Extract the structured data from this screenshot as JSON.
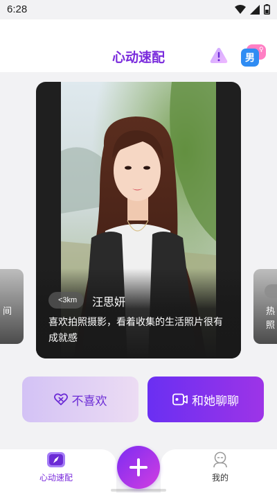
{
  "status_bar": {
    "time": "6:28"
  },
  "header": {
    "title": "心动速配",
    "gender_label": "男",
    "gender_badge": "♀"
  },
  "side_left": {
    "lines": [
      "间"
    ]
  },
  "side_right": {
    "lines": [
      "热",
      "照"
    ]
  },
  "card": {
    "distance": "<3km",
    "name": "汪思妍",
    "bio": "喜欢拍照摄影，看着收集的生活照片很有成就感"
  },
  "actions": {
    "dislike_label": "不喜欢",
    "chat_label": "和她聊聊"
  },
  "nav": {
    "match_label": "心动速配",
    "mine_label": "我的"
  },
  "colors": {
    "accent": "#7a2bdc",
    "chat_gradient_start": "#6a2ff2",
    "chat_gradient_end": "#9d34e7"
  }
}
